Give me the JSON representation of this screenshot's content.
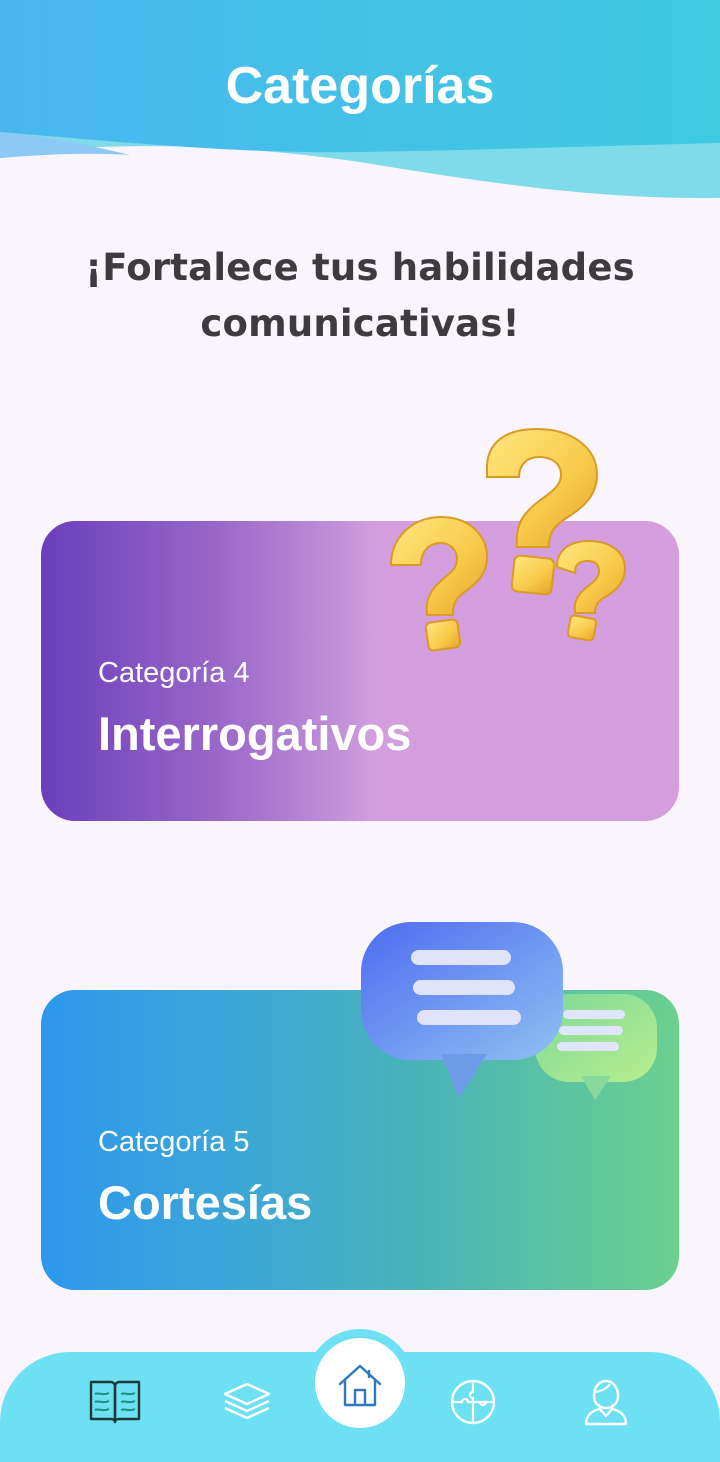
{
  "header": {
    "title": "Categorías"
  },
  "intro": {
    "line1": "¡Fortalece tus habilidades",
    "line2": "comunicativas!"
  },
  "cards": [
    {
      "kicker": "Categoría 4",
      "title": "Interrogativos",
      "icon": "question-marks-illustration"
    },
    {
      "kicker": "Categoría 5",
      "title": "Cortesías",
      "icon": "chat-bubbles-illustration"
    }
  ],
  "nav": {
    "items": [
      {
        "icon": "book-icon"
      },
      {
        "icon": "layers-icon"
      },
      {
        "icon": "home-icon",
        "active": true
      },
      {
        "icon": "puzzle-icon"
      },
      {
        "icon": "profile-icon"
      }
    ]
  },
  "colors": {
    "background": "#faf5fc",
    "header_top": "#4ab8ee",
    "nav_bar": "#6ee0f3",
    "card_purple_start": "#6a3ebb",
    "card_purple_end": "#d49ede",
    "card_teal_start": "#2d97ec",
    "card_teal_end": "#6bd18f"
  }
}
